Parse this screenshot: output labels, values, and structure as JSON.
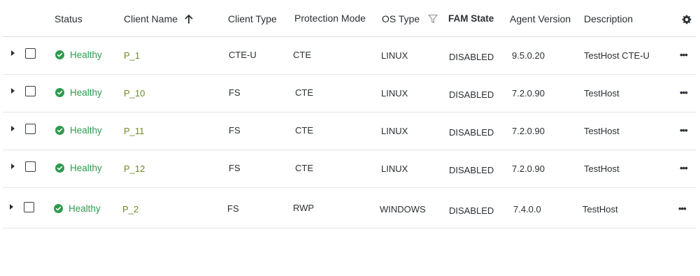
{
  "columns": {
    "status": "Status",
    "client_name": "Client Name",
    "client_type": "Client Type",
    "protection_mode": "Protection Mode",
    "os_type": "OS Type",
    "fam_state": "FAM State",
    "agent_version": "Agent Version",
    "description": "Description"
  },
  "sort": {
    "column": "client_name",
    "direction": "ascending"
  },
  "rows": [
    {
      "status": "Healthy",
      "client_name": "P_1",
      "client_type": "CTE-U",
      "protection_mode": "CTE",
      "os_type": "LINUX",
      "fam_state": "DISABLED",
      "agent_version": "9.5.0.20",
      "description": "TestHost CTE-U"
    },
    {
      "status": "Healthy",
      "client_name": "P_10",
      "client_type": "FS",
      "protection_mode": "CTE",
      "os_type": "LINUX",
      "fam_state": "DISABLED",
      "agent_version": "7.2.0.90",
      "description": "TestHost"
    },
    {
      "status": "Healthy",
      "client_name": "P_11",
      "client_type": "FS",
      "protection_mode": "CTE",
      "os_type": "LINUX",
      "fam_state": "DISABLED",
      "agent_version": "7.2.0.90",
      "description": "TestHost"
    },
    {
      "status": "Healthy",
      "client_name": "P_12",
      "client_type": "FS",
      "protection_mode": "CTE",
      "os_type": "LINUX",
      "fam_state": "DISABLED",
      "agent_version": "7.2.0.90",
      "description": "TestHost"
    },
    {
      "status": "Healthy",
      "client_name": "P_2",
      "client_type": "FS",
      "protection_mode": "RWP",
      "os_type": "WINDOWS",
      "fam_state": "DISABLED",
      "agent_version": "7.4.0.0",
      "description": "TestHost"
    }
  ],
  "row_actions_label": "•••",
  "colors": {
    "healthy": "#2e9a4e",
    "client_link": "#6b8a2a",
    "divider": "#d9dde1"
  },
  "icons": {
    "status_ok": "check-circle-icon",
    "sort": "arrow-up-icon",
    "filter": "funnel-icon",
    "settings": "gear-icon",
    "expand": "caret-right-icon",
    "row_actions": "ellipsis-icon"
  }
}
